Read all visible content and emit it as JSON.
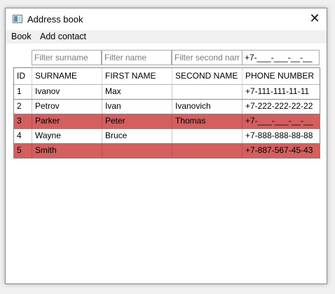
{
  "window": {
    "title": "Address book",
    "close_glyph": "✕"
  },
  "menu": {
    "items": [
      "Book",
      "Add contact"
    ]
  },
  "filters": {
    "surname_placeholder": "Filter surname",
    "name_placeholder": "Filter name",
    "second_name_placeholder": "Filter second name",
    "phone_value": "+7-___-___-__-__"
  },
  "table": {
    "headers": [
      "ID",
      "SURNAME",
      "FIRST NAME",
      "SECOND NAME",
      "PHONE NUMBER"
    ],
    "rows": [
      {
        "id": "1",
        "surname": "Ivanov",
        "first_name": "Max",
        "second_name": "",
        "phone": "+7-111-111-11-11",
        "highlight": false
      },
      {
        "id": "2",
        "surname": "Petrov",
        "first_name": "Ivan",
        "second_name": "Ivanovich",
        "phone": "+7-222-222-22-22",
        "highlight": false
      },
      {
        "id": "3",
        "surname": "Parker",
        "first_name": "Peter",
        "second_name": "Thomas",
        "phone": "+7-___-___-__-__",
        "highlight": true
      },
      {
        "id": "4",
        "surname": "Wayne",
        "first_name": "Bruce",
        "second_name": "",
        "phone": "+7-888-888-88-88",
        "highlight": false
      },
      {
        "id": "5",
        "surname": "Smith",
        "first_name": "",
        "second_name": "",
        "phone": "+7-887-567-45-43",
        "highlight": true
      }
    ]
  },
  "colors": {
    "highlight_row": "#d35f5f",
    "normal_row": "#ffffff"
  }
}
